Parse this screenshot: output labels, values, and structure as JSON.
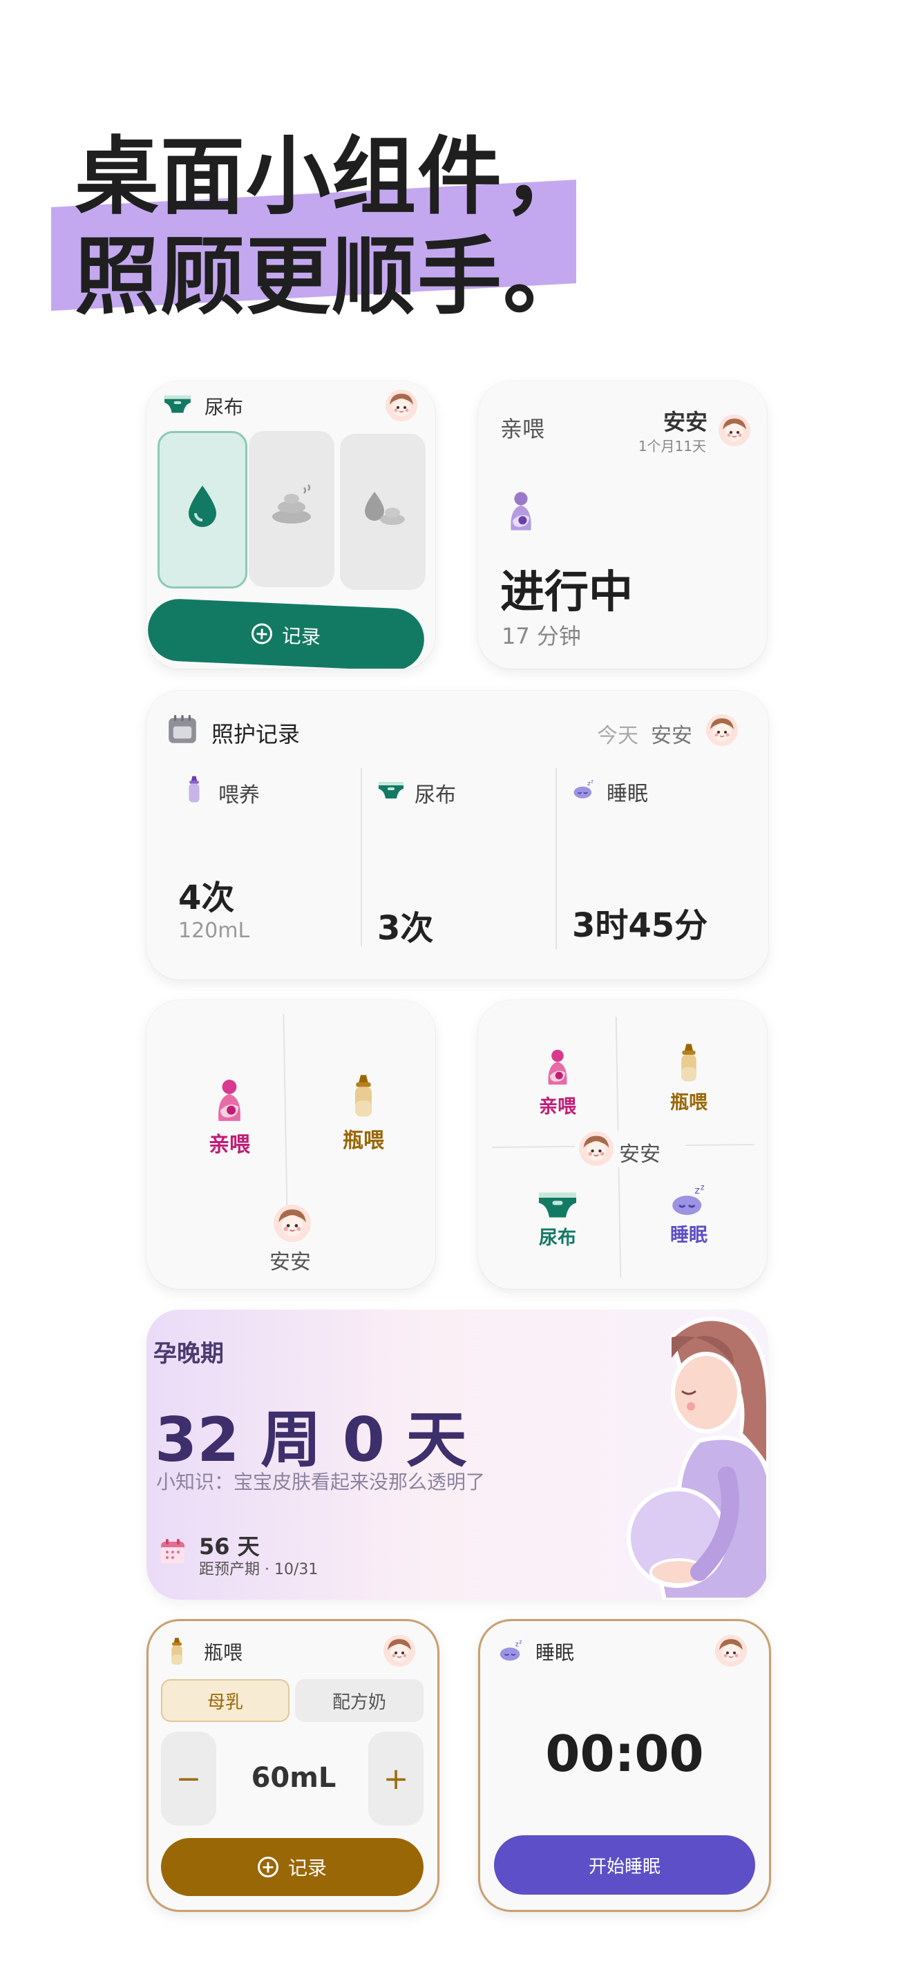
{
  "headline": {
    "line1": "桌面小组件，",
    "line2": "照顾更顺手。"
  },
  "baby_name": "安安",
  "diaper_widget": {
    "title": "尿布",
    "record_label": "记录",
    "colors": {
      "primary": "#127a63",
      "selected_tile": "#d9eee8"
    }
  },
  "nursing_widget": {
    "title": "亲喂",
    "baby_name": "安安",
    "age": "1个月11天",
    "status": "进行中",
    "duration": "17 分钟"
  },
  "care_log": {
    "title": "照护记录",
    "day": "今天",
    "baby_name": "安安",
    "columns": [
      {
        "label": "喂养",
        "value": "4次",
        "sub": "120mL"
      },
      {
        "label": "尿布",
        "value": "3次",
        "sub": ""
      },
      {
        "label": "睡眠",
        "value": "3时45分",
        "sub": ""
      }
    ]
  },
  "quick2": {
    "left": "亲喂",
    "right": "瓶喂",
    "baby_name": "安安"
  },
  "quick4": {
    "tl": "亲喂",
    "tr": "瓶喂",
    "bl": "尿布",
    "br": "睡眠",
    "baby_name": "安安"
  },
  "pregnancy": {
    "stage": "孕晚期",
    "weeks": "32 周 0 天",
    "tip": "小知识：宝宝皮肤看起来没那么透明了",
    "days_left": "56 天",
    "due_label": "距预产期 · 10/31"
  },
  "bottle_widget": {
    "title": "瓶喂",
    "options": [
      "母乳",
      "配方奶"
    ],
    "selected": "母乳",
    "minus": "−",
    "plus": "+",
    "amount": "60mL",
    "record_label": "记录",
    "colors": {
      "primary": "#9a6706"
    }
  },
  "sleep_widget": {
    "title": "睡眠",
    "timer": "00:00",
    "start_label": "开始睡眠",
    "colors": {
      "primary": "#5c4fc7"
    }
  }
}
